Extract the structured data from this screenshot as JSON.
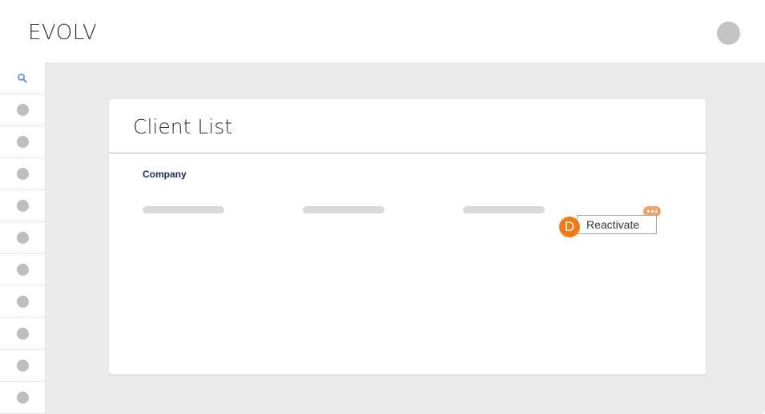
{
  "header": {
    "logo": "EVOLV"
  },
  "sidebar": {
    "items": [
      {
        "icon": "search-icon"
      },
      {
        "icon": "nav-dot-icon"
      },
      {
        "icon": "nav-dot-icon"
      },
      {
        "icon": "nav-dot-icon"
      },
      {
        "icon": "nav-dot-icon"
      },
      {
        "icon": "nav-dot-icon"
      },
      {
        "icon": "nav-dot-icon"
      },
      {
        "icon": "nav-dot-icon"
      },
      {
        "icon": "nav-dot-icon"
      },
      {
        "icon": "nav-dot-icon"
      },
      {
        "icon": "nav-dot-icon"
      }
    ]
  },
  "card": {
    "title": "Client List",
    "column_header": "Company",
    "row_menu": {
      "more_icon": "more-horizontal-icon",
      "badge_letter": "D",
      "item_label": "Reactivate"
    }
  },
  "colors": {
    "accent_orange": "#f07a15",
    "more_button": "#f2a36b",
    "header_text": "#1e2a4f",
    "background": "#ebebeb"
  }
}
